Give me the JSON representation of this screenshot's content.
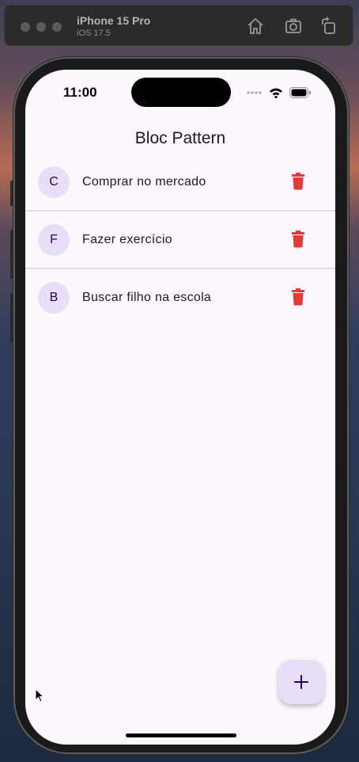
{
  "simulator": {
    "device_name": "iPhone 15 Pro",
    "os_version": "iOS 17.5",
    "buttons": [
      "home-icon",
      "screenshot-icon",
      "rotate-icon"
    ]
  },
  "status_bar": {
    "time": "11:00"
  },
  "app": {
    "title": "Bloc Pattern",
    "items": [
      {
        "initial": "C",
        "text": "Comprar no mercado"
      },
      {
        "initial": "F",
        "text": "Fazer exercício"
      },
      {
        "initial": "B",
        "text": "Buscar filho na escola"
      }
    ],
    "fab_icon": "plus-icon"
  },
  "colors": {
    "background": "#fdf7fe",
    "avatar_bg": "#e8def8",
    "avatar_text": "#21005d",
    "delete": "#e53935",
    "divider": "#e3dde6"
  }
}
